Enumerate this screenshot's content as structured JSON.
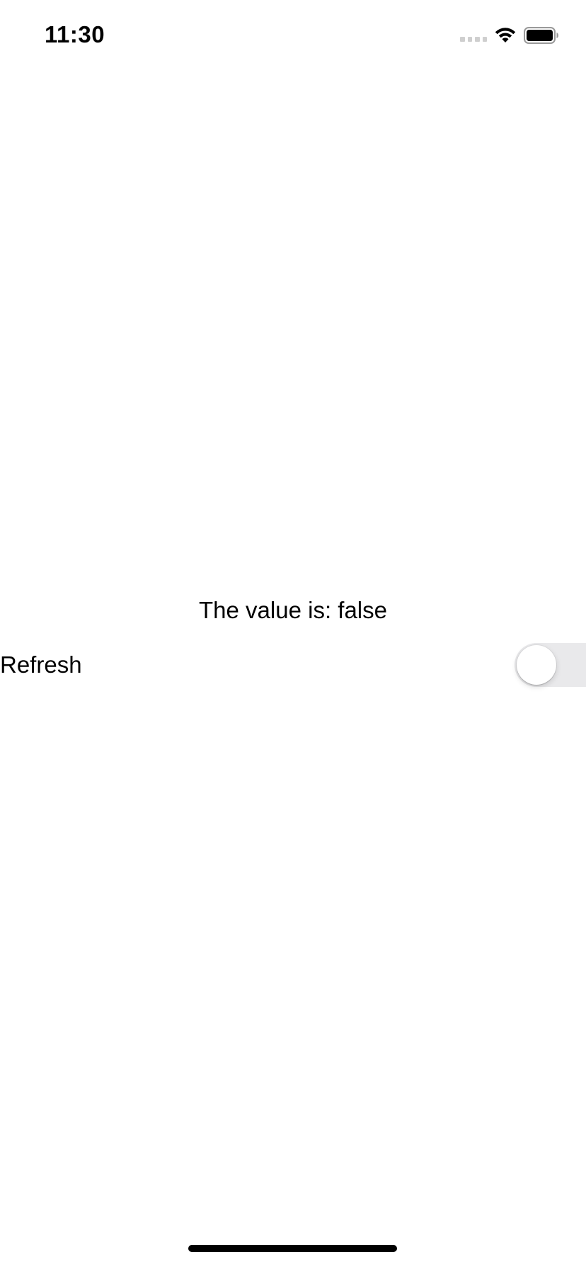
{
  "status_bar": {
    "time": "11:30",
    "icons": [
      "cellular-signal-icon",
      "wifi-icon",
      "battery-icon"
    ]
  },
  "main": {
    "value_label": "The value is: false",
    "refresh": {
      "label": "Refresh",
      "toggle_on": false
    }
  },
  "colors": {
    "background": "#ffffff",
    "text": "#000000",
    "toggle_off_track": "#e9e9eb",
    "toggle_knob": "#ffffff"
  }
}
